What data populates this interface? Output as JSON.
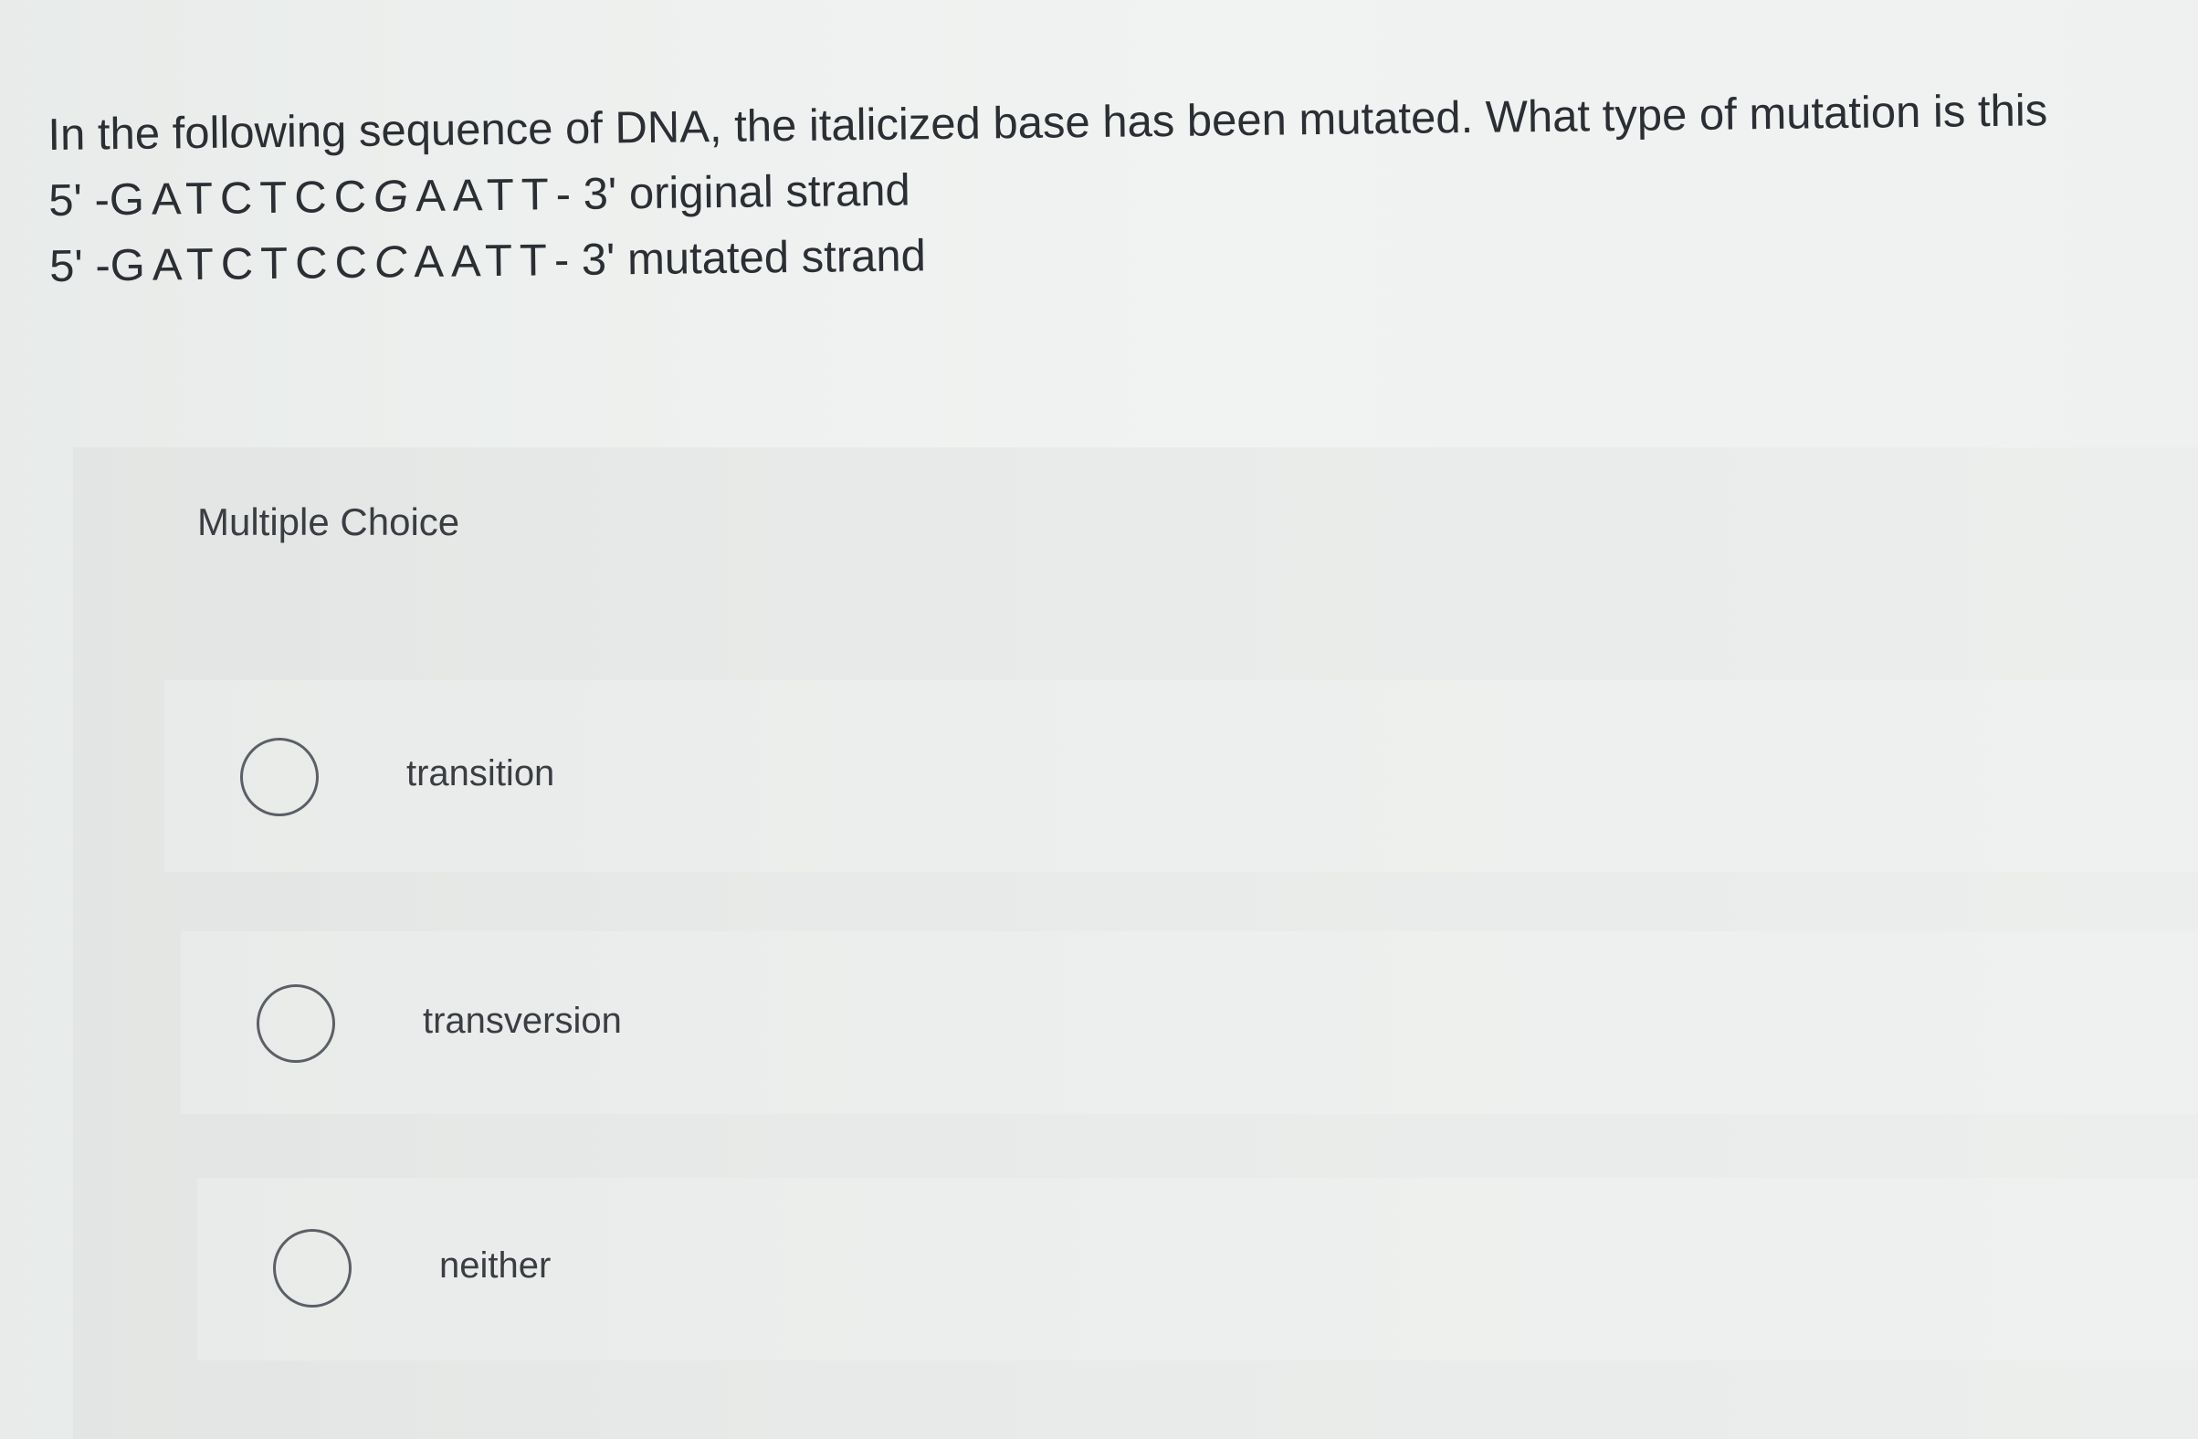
{
  "question": {
    "prompt": "In the following sequence of DNA, the italicized base has been mutated. What type of mutation is this",
    "original": {
      "prefix": "5' - ",
      "bases_before": "GATCTCC",
      "italic_base": "G",
      "bases_after": "AATT",
      "suffix": " - 3' original strand"
    },
    "mutated": {
      "prefix": "5' - ",
      "bases_before": "GATCTCC",
      "italic_base": "C",
      "bases_after": "AATT",
      "suffix": " - 3' mutated strand"
    }
  },
  "choices_panel": {
    "title": "Multiple Choice",
    "options": [
      {
        "label": "transition"
      },
      {
        "label": "transversion"
      },
      {
        "label": "neither"
      }
    ]
  },
  "colors": {
    "text": "#2b2e33",
    "panel_background": "#e8eae9",
    "radio_border": "#5b5f66"
  }
}
